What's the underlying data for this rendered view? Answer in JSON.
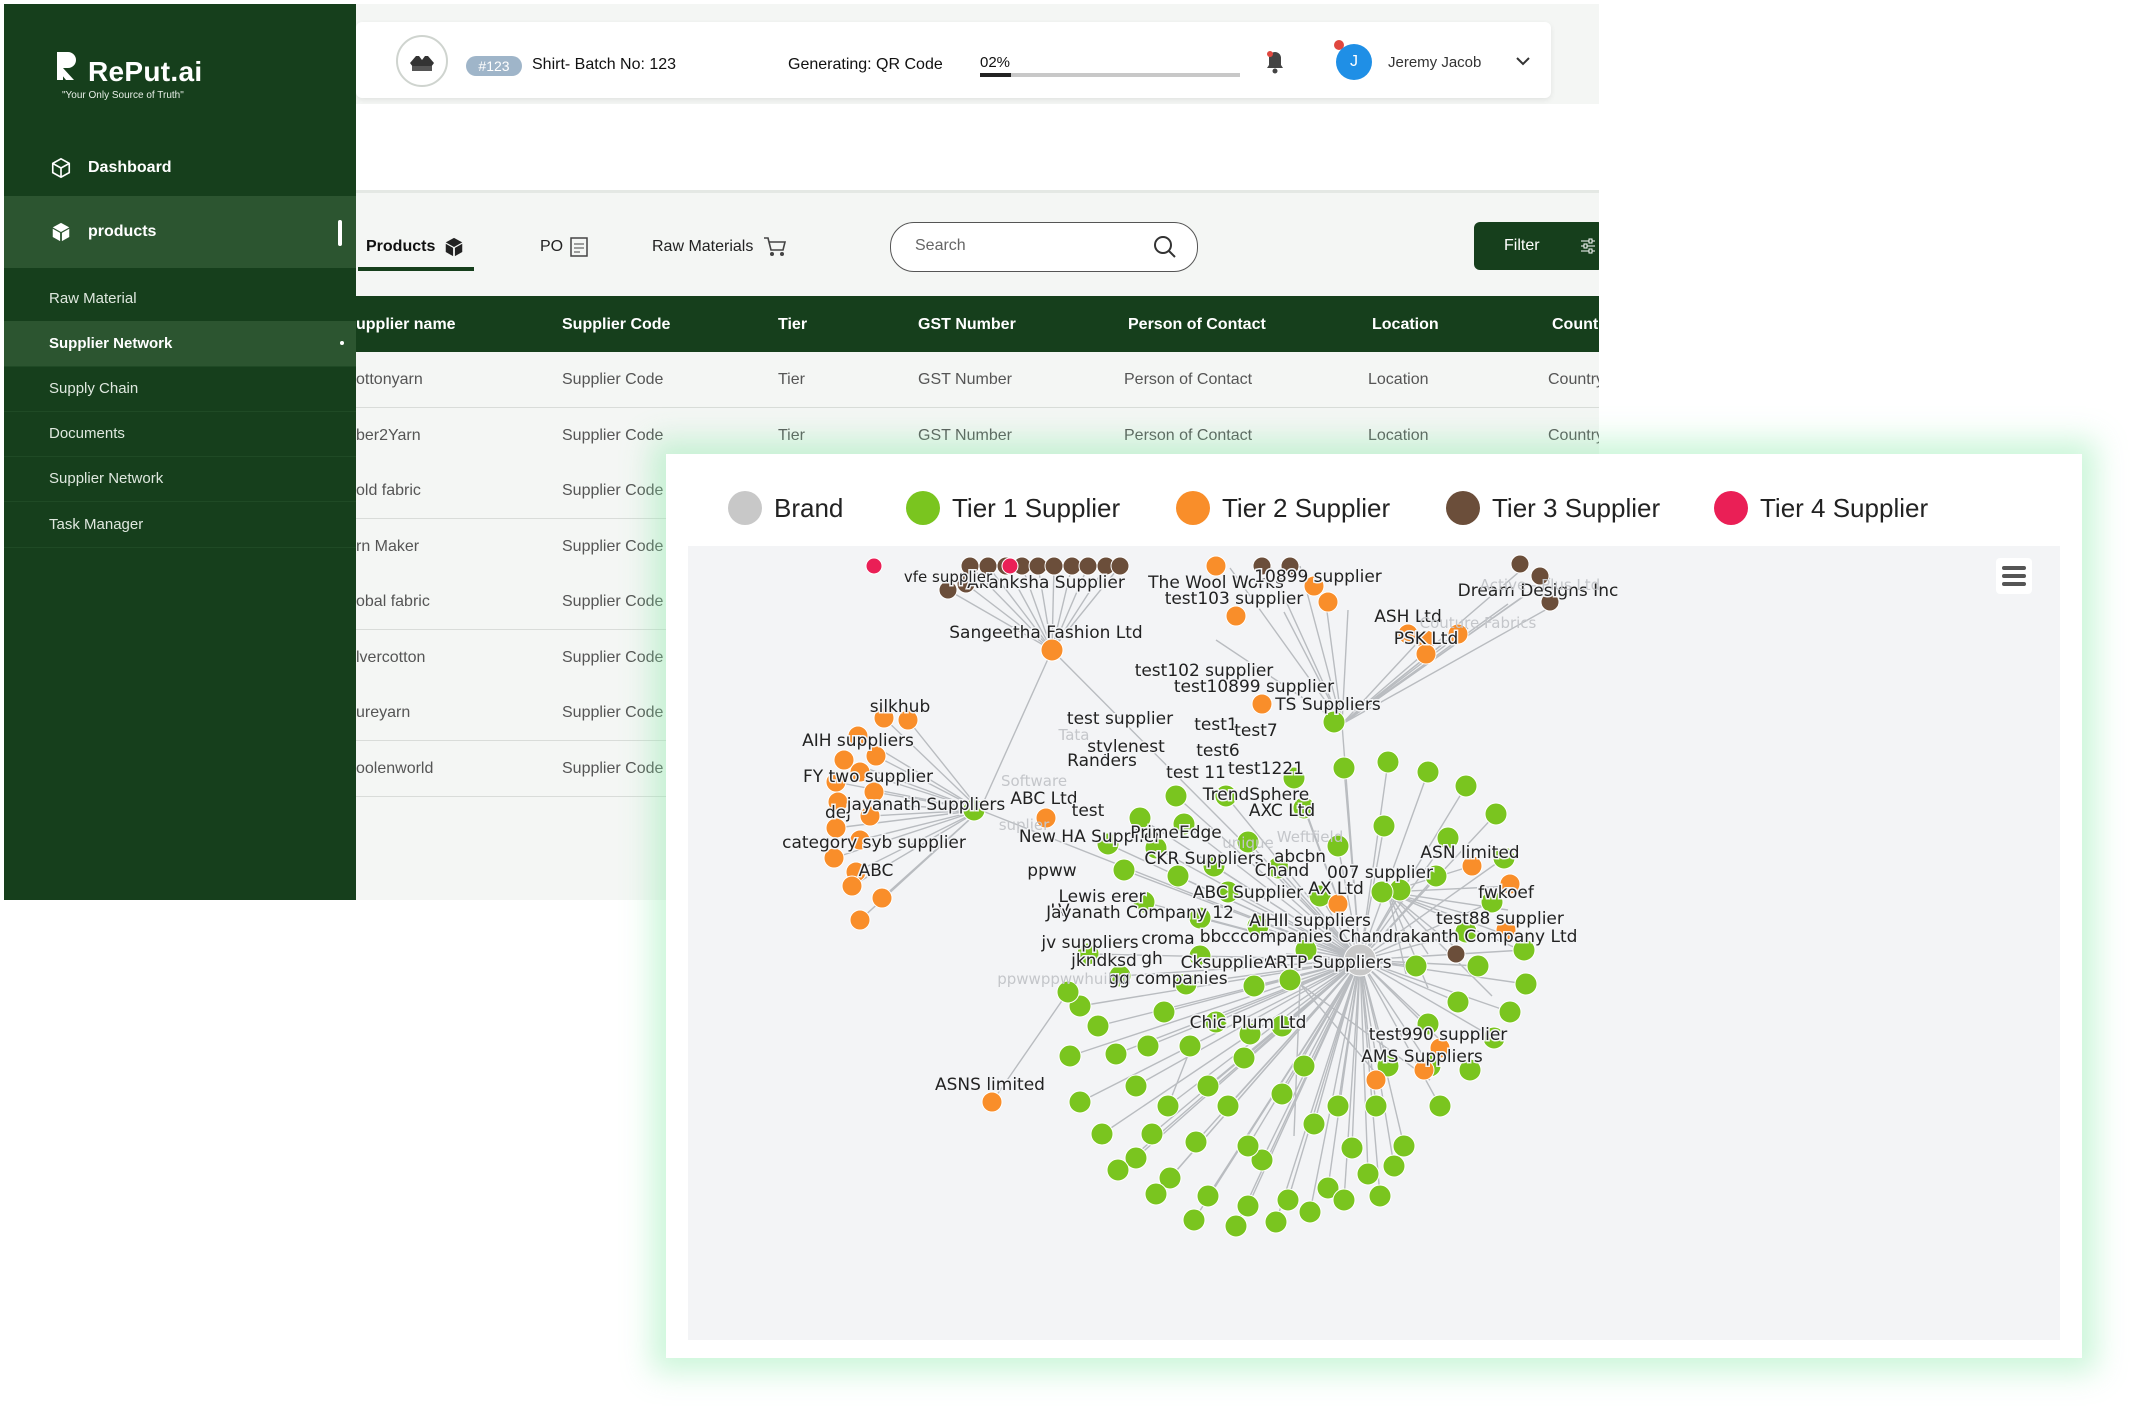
{
  "brand": {
    "name": "RePut.ai",
    "tagline": "\"Your Only Source of Truth\""
  },
  "sidebar": {
    "main": [
      {
        "label": "Dashboard",
        "icon": "cube-outline-icon",
        "active": false
      },
      {
        "label": "products",
        "icon": "cube-solid-icon",
        "active": true
      }
    ],
    "sub": [
      {
        "label": "Raw Material",
        "active": false
      },
      {
        "label": "Supplier Network",
        "active": true
      },
      {
        "label": "Supply Chain",
        "active": false
      },
      {
        "label": "Documents",
        "active": false
      },
      {
        "label": "Supplier Network",
        "active": false
      },
      {
        "label": "Task Manager",
        "active": false
      }
    ]
  },
  "topbar": {
    "batch_id": "#123",
    "batch_title": "Shirt- Batch No: 123",
    "generating_label": "Generating: QR Code",
    "progress_text": "02%",
    "progress_value": 0.12,
    "user_initial": "J",
    "user_name": "Jeremy Jacob",
    "avatar_color": "#1f8fe6"
  },
  "tabs": [
    {
      "label": "Products",
      "icon": "cube-solid-icon",
      "active": true
    },
    {
      "label": "PO",
      "icon": "document-icon",
      "active": false
    },
    {
      "label": "Raw Materials",
      "icon": "cart-icon",
      "active": false
    }
  ],
  "search": {
    "placeholder": "Search"
  },
  "filter": {
    "label": "Filter",
    "icon": "sliders-icon"
  },
  "table": {
    "headers": [
      "upplier name",
      "Supplier Code",
      "Tier",
      "GST  Number",
      "Person of Contact",
      "Location",
      "Countr"
    ],
    "rows": [
      [
        "ottonyarn",
        "Supplier Code",
        "Tier",
        "GST  Number",
        "Person of Contact",
        "Location",
        "Country"
      ],
      [
        "ber2Yarn",
        "Supplier Code",
        "Tier",
        "GST  Number",
        "Person of Contact",
        "Location",
        "Country"
      ],
      [
        "old fabric",
        "Supplier Code",
        "",
        "",
        "",
        "",
        ""
      ],
      [
        "rn Maker",
        "Supplier Code",
        "",
        "",
        "",
        "",
        ""
      ],
      [
        "obal fabric",
        "Supplier Code",
        "",
        "",
        "",
        "",
        ""
      ],
      [
        "lvercotton",
        "Supplier Code",
        "",
        "",
        "",
        "",
        ""
      ],
      [
        "ureyarn",
        "Supplier Code",
        "",
        "",
        "",
        "",
        ""
      ],
      [
        "oolenworld",
        "Supplier Code",
        "",
        "",
        "",
        "",
        ""
      ]
    ]
  },
  "network": {
    "legend": [
      {
        "label": "Brand",
        "color": "#c8c8c8"
      },
      {
        "label": "Tier 1 Supplier",
        "color": "#7ac51f"
      },
      {
        "label": "Tier 2 Supplier",
        "color": "#f98e2a"
      },
      {
        "label": "Tier 3 Supplier",
        "color": "#6b4e3a"
      },
      {
        "label": "Tier 4 Supplier",
        "color": "#ea1f56"
      }
    ],
    "labels": {
      "hub": "PrimeEdge",
      "akanksha": "Akanksha Supplier",
      "vfe": "vfe supplier",
      "sangeetha": "Sangeetha Fashion Ltd",
      "woolworks": "The Wool Works",
      "s10899": "10899 supplier",
      "test103": "test103 supplier",
      "dream": "Dream Designs Inc",
      "active": "Active - Plus Ltd",
      "ash": "ASH Ltd",
      "psk": "PSK Ltd",
      "couture": "Couture Fabrics",
      "test102": "test102 supplier",
      "test10899": "test10899 supplier",
      "ts": "TS Suppliers",
      "silkhub": "silkhub",
      "aih": "AIH suppliers",
      "fytwo": "FY two supplier",
      "dej": "dej",
      "jayanath": "jayanath Suppliers",
      "catsyb": "category syb supplier",
      "abc": "ABC",
      "testsupplier": "test supplier",
      "test1": "test1",
      "test7": "test7",
      "stylenest": "stylenest",
      "test6": "test6",
      "randers": "Randers",
      "test11": "test 11",
      "test1221": "test1221",
      "trendsphere": "TrendSphere",
      "abcltd": "ABC Ltd",
      "axcltd": "AXC Ltd",
      "test": "test",
      "newha": "New HA Supplier",
      "unique": "unique",
      "weftfield": "Weftfield",
      "abcbn": "abcbn",
      "ckr": "CKR Suppliers",
      "ppww": "ppww",
      "chand": "Chand",
      "s007": "007 supplier",
      "asnlimited": "ASN limited",
      "fwkoef": "fwkoef",
      "abcsupplier": "ABC Supplier",
      "axltd": "AX Ltd",
      "lewis": "Lewis erer",
      "lv": "LV",
      "jayanath12": "Jayanath Company 12",
      "aihii": "AIHII suppliers",
      "test88": "test88 supplier",
      "bbcc": "bbcccompanies",
      "chandrakanth": "Chandrakanth Company Ltd",
      "croma": "croma",
      "jvsup": "jv suppliers",
      "jknd": "jkndksd",
      "gh": "gh",
      "ckss": "Cksuppliers",
      "artp": "ARTP Suppliers",
      "ggcomp": "gg companies",
      "ppwwp": "ppwwppwwhuihui",
      "chic": "Chic Plum Ltd",
      "test990": "test990 supplier",
      "ams": "AMS Suppliers",
      "asnslimited": "ASNS limited",
      "tata": "Tata",
      "software": "Software",
      "suplier": "suplier"
    }
  }
}
